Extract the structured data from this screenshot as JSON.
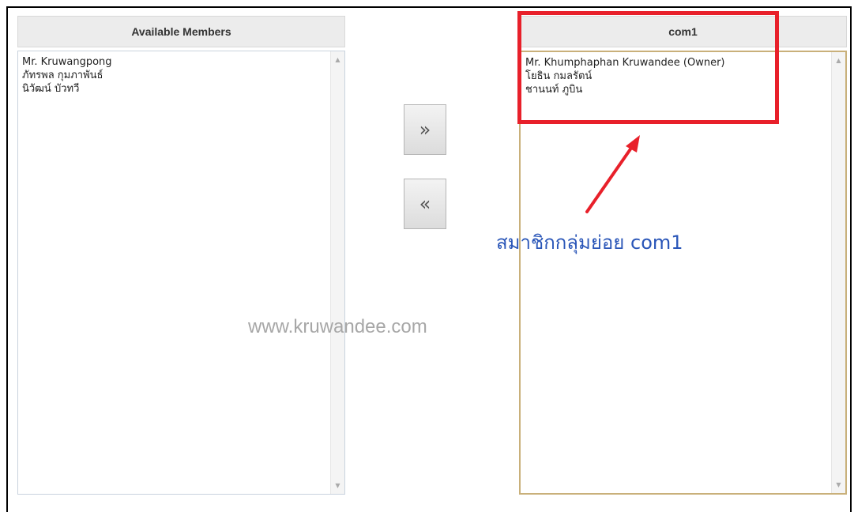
{
  "available_panel": {
    "title": "Available Members",
    "items": [
      "Mr. Kruwangpong",
      "ภัทรพล กุมภาพันธ์",
      "นิวัฒน์ บัวทวี"
    ]
  },
  "group_panel": {
    "title": "com1",
    "items": [
      "Mr. Khumphaphan Kruwandee (Owner)",
      "โยธิน กมลรัตน์",
      "ชานนท์ ภูบิน"
    ]
  },
  "buttons": {
    "add_label": "»",
    "remove_label": "«"
  },
  "annotation": {
    "text": "สมาชิกกลุ่มย่อย com1",
    "color": "#2a56b8",
    "highlight_color": "#e8202a"
  },
  "watermark": "www.kruwandee.com"
}
